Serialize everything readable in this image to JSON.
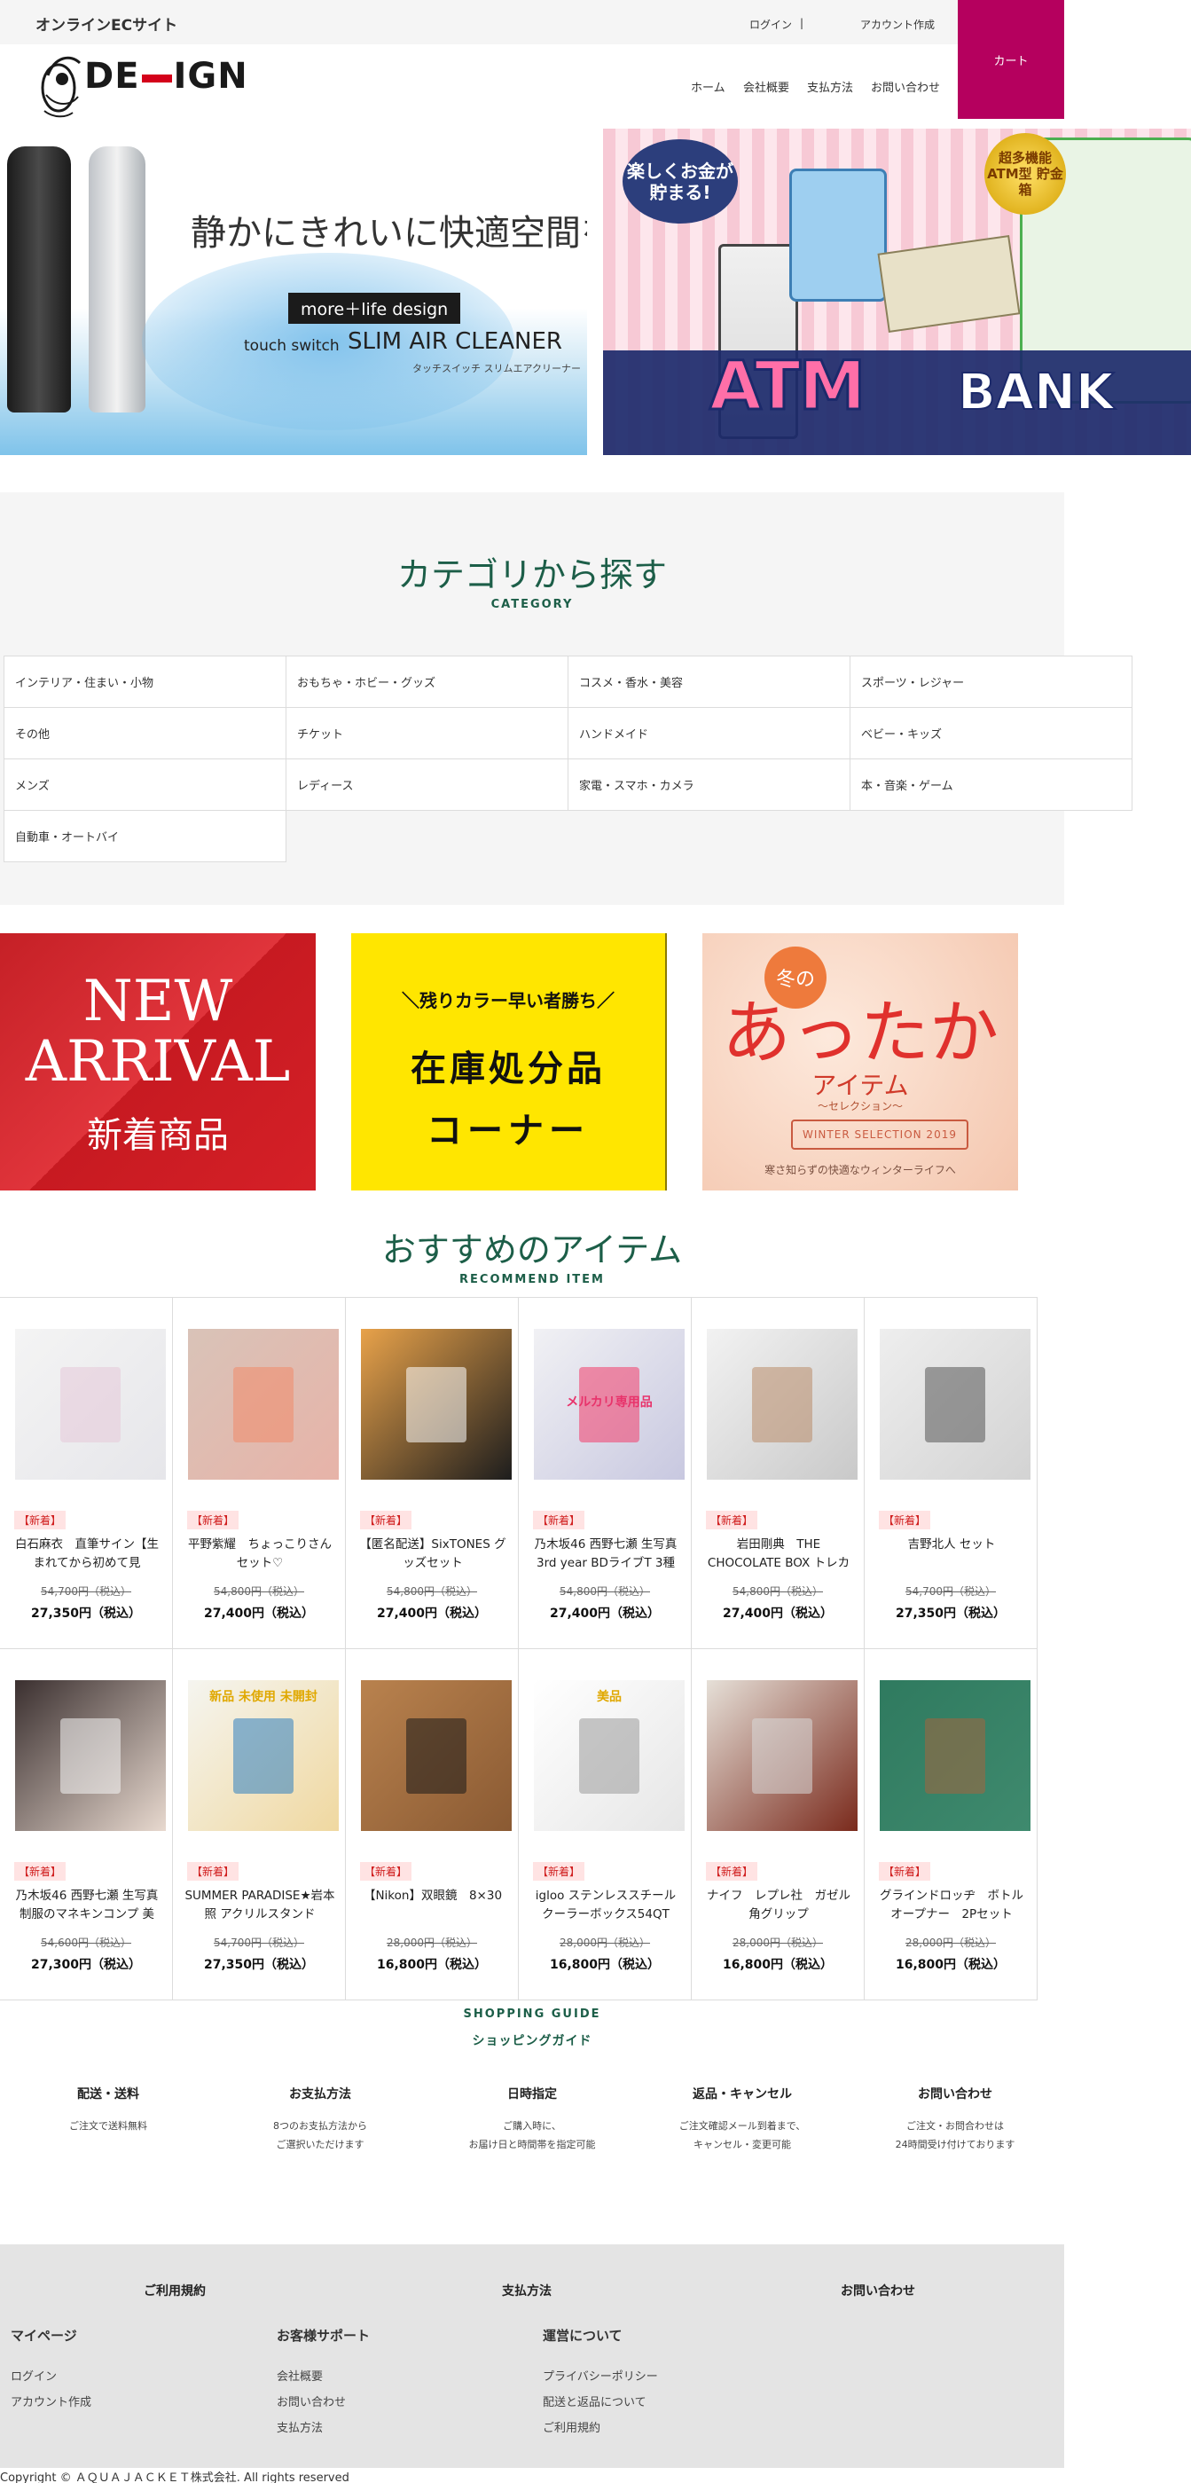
{
  "topbar": {
    "site_label": "オンラインECサイト",
    "login": "ログイン",
    "separator": "|",
    "account": "アカウント作成",
    "cart": "カート"
  },
  "header": {
    "logo_text_a": "DE",
    "logo_text_b": "IGN",
    "nav": [
      "ホーム",
      "会社概要",
      "支払方法",
      "お問い合わせ"
    ]
  },
  "hero_left": {
    "headline": "静かにきれいに快適空間を",
    "tag": "more＋life design",
    "sub1": "touch switch",
    "sub2": "SLIM AIR CLEANER",
    "sub3": "タッチスイッチ スリムエアクリーナー"
  },
  "hero_right": {
    "bubble": "楽しくお金が貯まる!",
    "badge": "超多機能 ATM型 貯金箱",
    "title_a": "ATM",
    "title_b": "BANK"
  },
  "category": {
    "title": "カテゴリから探す",
    "subtitle": "CATEGORY",
    "items": [
      "インテリア・住まい・小物",
      "おもちゃ・ホビー・グッズ",
      "コスメ・香水・美容",
      "スポーツ・レジャー",
      "その他",
      "チケット",
      "ハンドメイド",
      "ベビー・キッズ",
      "メンズ",
      "レディース",
      "家電・スマホ・カメラ",
      "本・音楽・ゲーム",
      "自動車・オートバイ"
    ]
  },
  "promos": {
    "new_l1": "NEW",
    "new_l2": "ARRIVAL",
    "new_l3": "新着商品",
    "stock_l1": "＼残りカラー早い者勝ち／",
    "stock_l2": "在庫処分品",
    "stock_l3": "コーナー",
    "warm_sun": "冬の",
    "warm_l1": "あったか",
    "warm_l2": "アイテム",
    "warm_l3": "〜セレクション〜",
    "warm_ribbon": "WINTER SELECTION 2019",
    "warm_l4": "寒さ知らずの快適なウィンターライフへ"
  },
  "recommend": {
    "title": "おすすめのアイテム",
    "subtitle": "RECOMMEND ITEM",
    "badge": "【新着】",
    "items": [
      {
        "name": "白石麻衣　直筆サイン【生まれてから初めて見",
        "old": "54,700円（税込）",
        "price": "27,350円（税込）"
      },
      {
        "name": "平野紫耀　ちょっこりさんセット♡",
        "old": "54,800円（税込）",
        "price": "27,400円（税込）"
      },
      {
        "name": "【匿名配送】SixTONES グッズセット",
        "old": "54,800円（税込）",
        "price": "27,400円（税込）"
      },
      {
        "name": "乃木坂46 西野七瀬 生写真 3rd year BDライブT 3種",
        "old": "54,800円（税込）",
        "price": "27,400円（税込）"
      },
      {
        "name": "岩田剛典　THE CHOCOLATE BOX トレカ",
        "old": "54,800円（税込）",
        "price": "27,400円（税込）"
      },
      {
        "name": "吉野北人 セット",
        "old": "54,700円（税込）",
        "price": "27,350円（税込）"
      },
      {
        "name": "乃木坂46 西野七瀬 生写真 制服のマネキンコンプ 美",
        "old": "54,600円（税込）",
        "price": "27,300円（税込）"
      },
      {
        "name": "SUMMER PARADISE★岩本照 アクリルスタンド",
        "old": "54,700円（税込）",
        "price": "27,350円（税込）"
      },
      {
        "name": "【Nikon】双眼鏡　8×30",
        "old": "28,000円（税込）",
        "price": "16,800円（税込）"
      },
      {
        "name": "igloo ステンレススチール クーラーボックス54QT",
        "old": "28,000円（税込）",
        "price": "16,800円（税込）"
      },
      {
        "name": "ナイフ　レプレ社　ガゼル角グリップ",
        "old": "28,000円（税込）",
        "price": "16,800円（税込）"
      },
      {
        "name": "グラインドロッヂ　ボトルオープナー　2Pセット",
        "old": "28,000円（税込）",
        "price": "16,800円（税込）"
      }
    ],
    "thumb_label_4": "メルカリ専用品",
    "thumb_label_8": "新品 未使用 未開封",
    "thumb_label_10": "美品"
  },
  "guide": {
    "title": "SHOPPING GUIDE",
    "subtitle": "ショッピングガイド",
    "cols": [
      {
        "h": "配送・送料",
        "t1": "ご注文で送料無料",
        "t2": ""
      },
      {
        "h": "お支払方法",
        "t1": "8つのお支払方法から",
        "t2": "ご選択いただけます"
      },
      {
        "h": "日時指定",
        "t1": "ご購入時に、",
        "t2": "お届け日と時間帯を指定可能"
      },
      {
        "h": "返品・キャンセル",
        "t1": "ご注文確認メール到着まで、",
        "t2": "キャンセル・変更可能"
      },
      {
        "h": "お問い合わせ",
        "t1": "ご注文・お問合わせは",
        "t2": "24時間受け付けております"
      }
    ]
  },
  "footer": {
    "top": [
      "ご利用規約",
      "支払方法",
      "お問い合わせ"
    ],
    "col1_h": "マイページ",
    "col1": [
      "ログイン",
      "アカウント作成"
    ],
    "col2_h": "お客様サポート",
    "col2": [
      "会社概要",
      "お問い合わせ",
      "支払方法"
    ],
    "col3_h": "運営について",
    "col3": [
      "プライバシーポリシー",
      "配送と返品について",
      "ご利用規約"
    ],
    "copyright": "Copyright © ＡＱＵＡＪＡＣＫＥＴ株式会社. All rights reserved"
  }
}
